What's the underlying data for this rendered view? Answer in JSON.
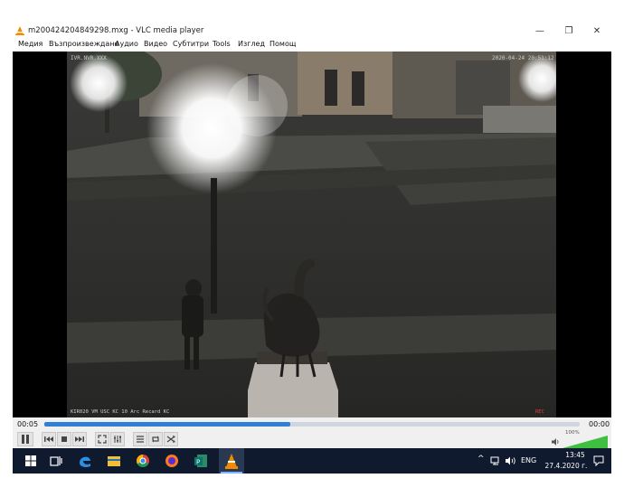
{
  "window": {
    "title": "m200424204849298.mxg - VLC media player",
    "minimize_glyph": "—",
    "restore_glyph": "❐",
    "close_glyph": "✕"
  },
  "menu": {
    "items": [
      "Медия",
      "Възпроизвеждане",
      "Аудио",
      "Видео",
      "Субтитри",
      "Tools",
      "Изглед",
      "Помощ"
    ]
  },
  "video": {
    "overlay_top_left": "IVR.NVR.XXX",
    "overlay_top_right": "2020-04-24 20:51:12",
    "overlay_bottom_left": "KIR020 VM USC KC 10 Arc Recard KC",
    "overlay_bottom_right": "REC"
  },
  "playback": {
    "time_elapsed": "00:05",
    "time_total": "00:00",
    "progress_fraction": 0.46,
    "state": "playing",
    "volume_percent": "100%",
    "volume_fraction": 1.0
  },
  "taskbar": {
    "icons": [
      "windows-start-icon",
      "task-view-icon",
      "edge-icon",
      "file-explorer-icon",
      "chrome-icon",
      "firefox-icon",
      "publisher-icon",
      "vlc-icon"
    ],
    "tray_language": "ENG",
    "tray_time": "13:45",
    "tray_date": "27.4.2020 г.",
    "tray_chevron": "^"
  },
  "colors": {
    "accent": "#2f7fd6",
    "taskbar": "#0f1a2e",
    "vlc_orange": "#f08a00"
  }
}
